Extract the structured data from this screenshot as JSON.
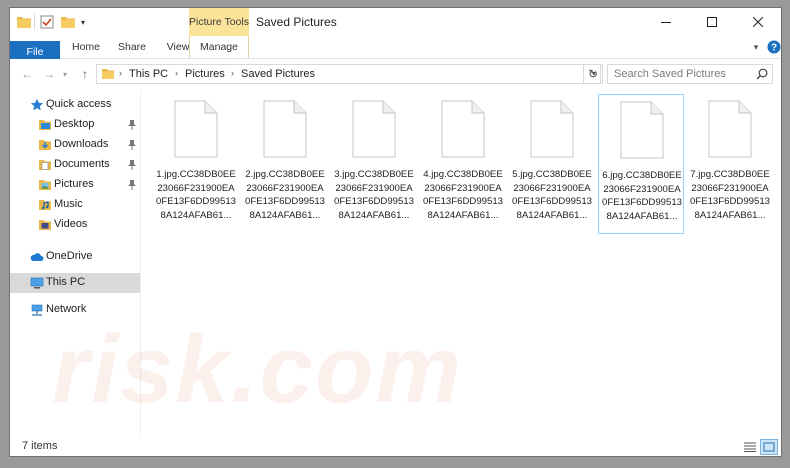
{
  "window": {
    "title": "Saved Pictures",
    "context_tab_group": "Picture Tools"
  },
  "ribbon": {
    "tabs": [
      {
        "label": "File"
      },
      {
        "label": "Home"
      },
      {
        "label": "Share"
      },
      {
        "label": "View"
      },
      {
        "label": "Manage"
      }
    ]
  },
  "address": {
    "crumbs": [
      "This PC",
      "Pictures",
      "Saved Pictures"
    ]
  },
  "search": {
    "placeholder": "Search Saved Pictures"
  },
  "sidebar": {
    "quick_access_label": "Quick access",
    "quick_access_items": [
      {
        "label": "Desktop",
        "pinned": true
      },
      {
        "label": "Downloads",
        "pinned": true
      },
      {
        "label": "Documents",
        "pinned": true
      },
      {
        "label": "Pictures",
        "pinned": true
      },
      {
        "label": "Music",
        "pinned": false
      },
      {
        "label": "Videos",
        "pinned": false
      }
    ],
    "onedrive_label": "OneDrive",
    "thispc_label": "This PC",
    "network_label": "Network"
  },
  "files": [
    {
      "name": "1.jpg.CC38DB0EE23066F231900EA0FE13F6DD995138A124AFAB61..."
    },
    {
      "name": "2.jpg.CC38DB0EE23066F231900EA0FE13F6DD995138A124AFAB61..."
    },
    {
      "name": "3.jpg.CC38DB0EE23066F231900EA0FE13F6DD995138A124AFAB61..."
    },
    {
      "name": "4.jpg.CC38DB0EE23066F231900EA0FE13F6DD995138A124AFAB61..."
    },
    {
      "name": "5.jpg.CC38DB0EE23066F231900EA0FE13F6DD995138A124AFAB61..."
    },
    {
      "name": "6.jpg.CC38DB0EE23066F231900EA0FE13F6DD995138A124AFAB61..."
    },
    {
      "name": "7.jpg.CC38DB0EE23066F231900EA0FE13F6DD995138A124AFAB61..."
    }
  ],
  "status": {
    "item_count": "7 items"
  },
  "watermark": {
    "text": "risk.com"
  },
  "colors": {
    "accent": "#1a6fc1",
    "context_tab": "#fbe39a",
    "selection_border": "#99d1ff",
    "nav_selected": "#d9d9d9"
  }
}
